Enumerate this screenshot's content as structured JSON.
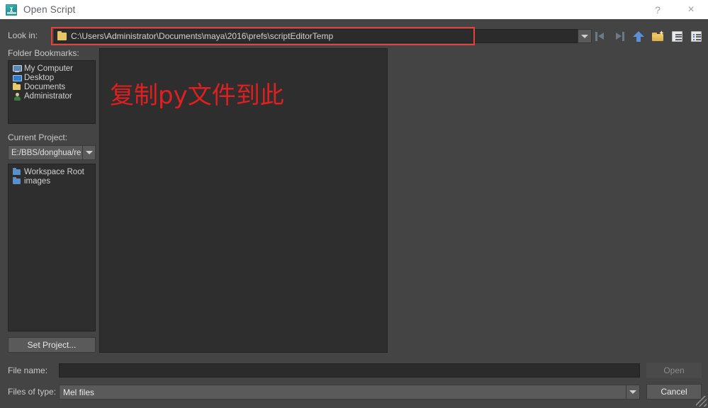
{
  "window": {
    "title": "Open Script",
    "icon": "maya-app-icon",
    "help_label": "?",
    "close_label": "×"
  },
  "toolbar": {
    "lookin_label": "Look in:",
    "path_value": "C:\\Users\\Administrator\\Documents\\maya\\2016\\prefs\\scriptEditorTemp",
    "path_highlight_color": "#e8413a",
    "icons": [
      {
        "name": "back-icon",
        "label": "Back",
        "enabled": false
      },
      {
        "name": "forward-icon",
        "label": "Forward",
        "enabled": false
      },
      {
        "name": "parent-directory-icon",
        "label": "Parent Directory",
        "enabled": true
      },
      {
        "name": "new-folder-icon",
        "label": "Create New Folder",
        "enabled": true
      },
      {
        "name": "list-view-icon",
        "label": "List View",
        "enabled": true
      },
      {
        "name": "detail-view-icon",
        "label": "Detail View",
        "enabled": true
      }
    ]
  },
  "sidebar": {
    "bookmarks_label": "Folder Bookmarks:",
    "bookmarks": [
      {
        "label": "My Computer",
        "icon": "computer-icon"
      },
      {
        "label": "Desktop",
        "icon": "desktop-icon"
      },
      {
        "label": "Documents",
        "icon": "folder-yellow-icon"
      },
      {
        "label": "Administrator",
        "icon": "user-icon"
      }
    ],
    "project_label": "Current Project:",
    "project_value": "E:/BBS/donghua/re",
    "project_items": [
      {
        "label": "Workspace Root",
        "icon": "folder-blue-icon"
      },
      {
        "label": "images",
        "icon": "folder-blue-icon"
      }
    ],
    "set_project_label": "Set Project..."
  },
  "file_area": {
    "annotation_text": "复制py文件到此",
    "annotation_color": "#e01f1f",
    "files": []
  },
  "footer": {
    "filename_label": "File name:",
    "filename_value": "",
    "filename_placeholder": "",
    "filetype_label": "Files of type:",
    "filetype_value": "Mel files",
    "open_label": "Open",
    "open_enabled": false,
    "cancel_label": "Cancel"
  }
}
